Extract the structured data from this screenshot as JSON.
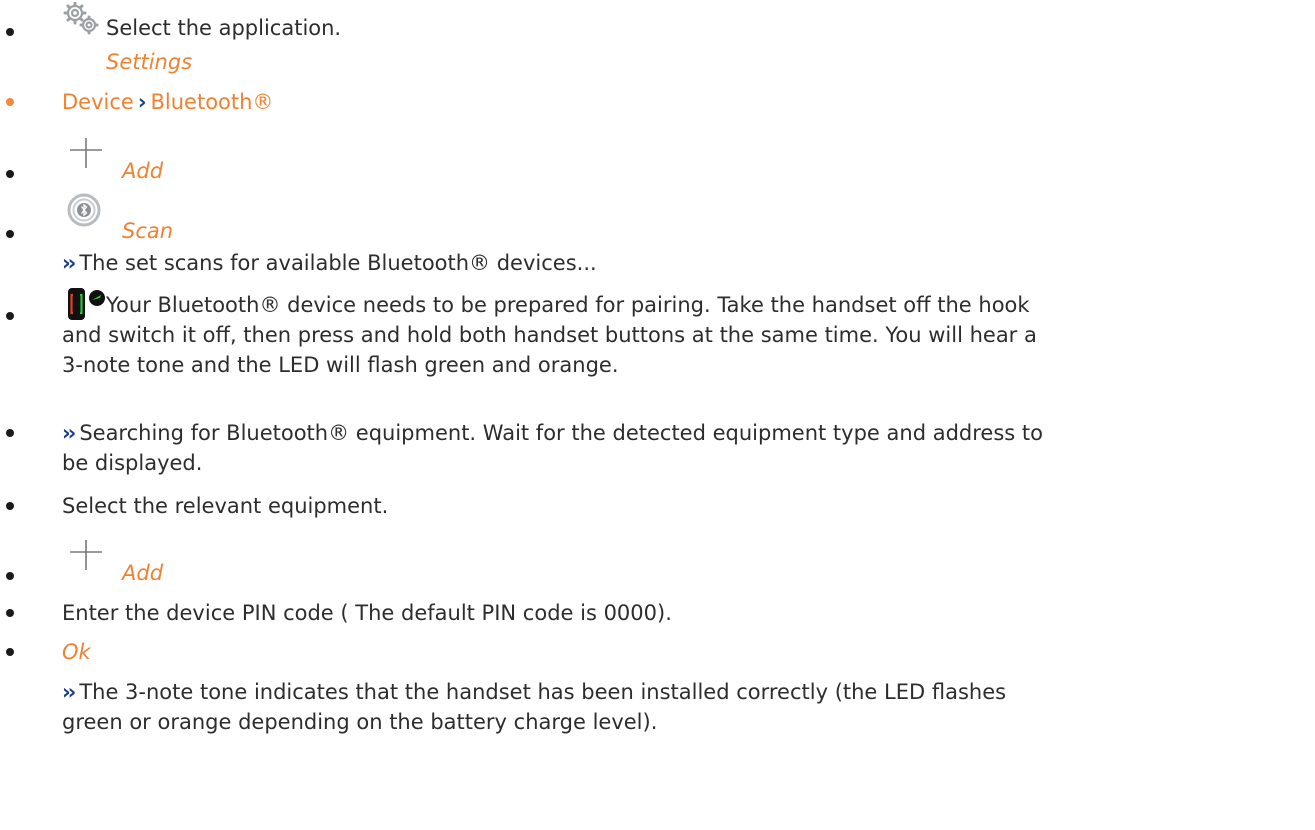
{
  "steps": {
    "s1": {
      "icon": "settings-gears-icon",
      "text": "Select the application.",
      "sub": "Settings"
    },
    "s2": {
      "part1": "Device",
      "separator": "›",
      "part2": "Bluetooth®"
    },
    "s3": {
      "icon": "add-plus-icon",
      "label": "Add"
    },
    "s4": {
      "icon": "bluetooth-scan-icon",
      "label": "Scan",
      "result_marker": "››",
      "result": "The set scans for available Bluetooth® devices..."
    },
    "s5": {
      "icon": "handset-icon",
      "line1": "Your Bluetooth® device needs to be prepared for pairing. Take the handset off the hook",
      "line2": "and switch it off, then press and hold both handset buttons at the same time. You will hear a",
      "line3": "3-note tone and the LED will flash green and orange."
    },
    "s6": {
      "marker": "››",
      "line1": "Searching for Bluetooth® equipment. Wait for the detected equipment type and address to",
      "line2": "be displayed."
    },
    "s7": {
      "text": "Select the relevant equipment."
    },
    "s8": {
      "icon": "add-plus-icon",
      "label": "Add"
    },
    "s9": {
      "text": "Enter the device PIN code ( The default PIN code is 0000)."
    },
    "s10": {
      "label": "Ok",
      "result_marker": "››",
      "line1": "The 3-note tone indicates that the handset has been installed correctly (the LED flashes",
      "line2": "green or orange depending on the battery charge level)."
    }
  },
  "colors": {
    "accent": "#ef8232",
    "marker": "#1b3f87",
    "text": "#2d2d2d"
  }
}
